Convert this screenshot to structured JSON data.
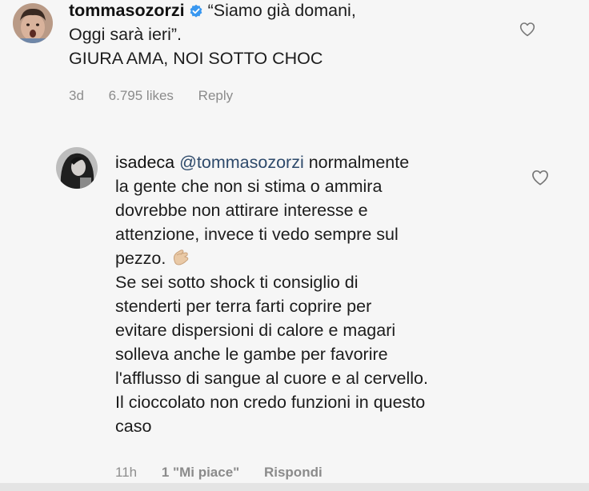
{
  "comment_1": {
    "username": "tommasozorzi",
    "line_1": "“Siamo già domani,",
    "line_2": "Oggi sarà ieri”.",
    "line_3": "GIURA AMA, NOI SOTTO CHOC",
    "time": "3d",
    "likes": "6.795 likes",
    "reply_label": "Reply",
    "verified_icon": "verified-badge-icon",
    "like_icon": "heart-outline-icon"
  },
  "comment_2": {
    "username": "isadeca",
    "mention": "@tommasozorzi",
    "lines": [
      "normalmente",
      "la gente che non si stima o ammira",
      "dovrebbe non attirare interesse e",
      "attenzione, invece ti vedo sempre sul",
      "pezzo.",
      "Se sei sotto shock ti consiglio di",
      "stenderti per terra farti coprire per",
      "evitare dispersioni di calore e magari",
      "solleva anche le gambe per favorire",
      "l'afflusso di sangue al cuore e al cervello.",
      "Il cioccolato non credo funzioni in questo",
      "caso"
    ],
    "emoji": "clapping-hands-emoji",
    "time": "11h",
    "likes": "1 \"Mi piace\"",
    "reply_label": "Rispondi",
    "like_icon": "heart-outline-icon"
  },
  "colors": {
    "background": "#f6f6f6",
    "text": "#1c1c1c",
    "meta": "#8e8e8e",
    "verified": "#3897f0"
  }
}
